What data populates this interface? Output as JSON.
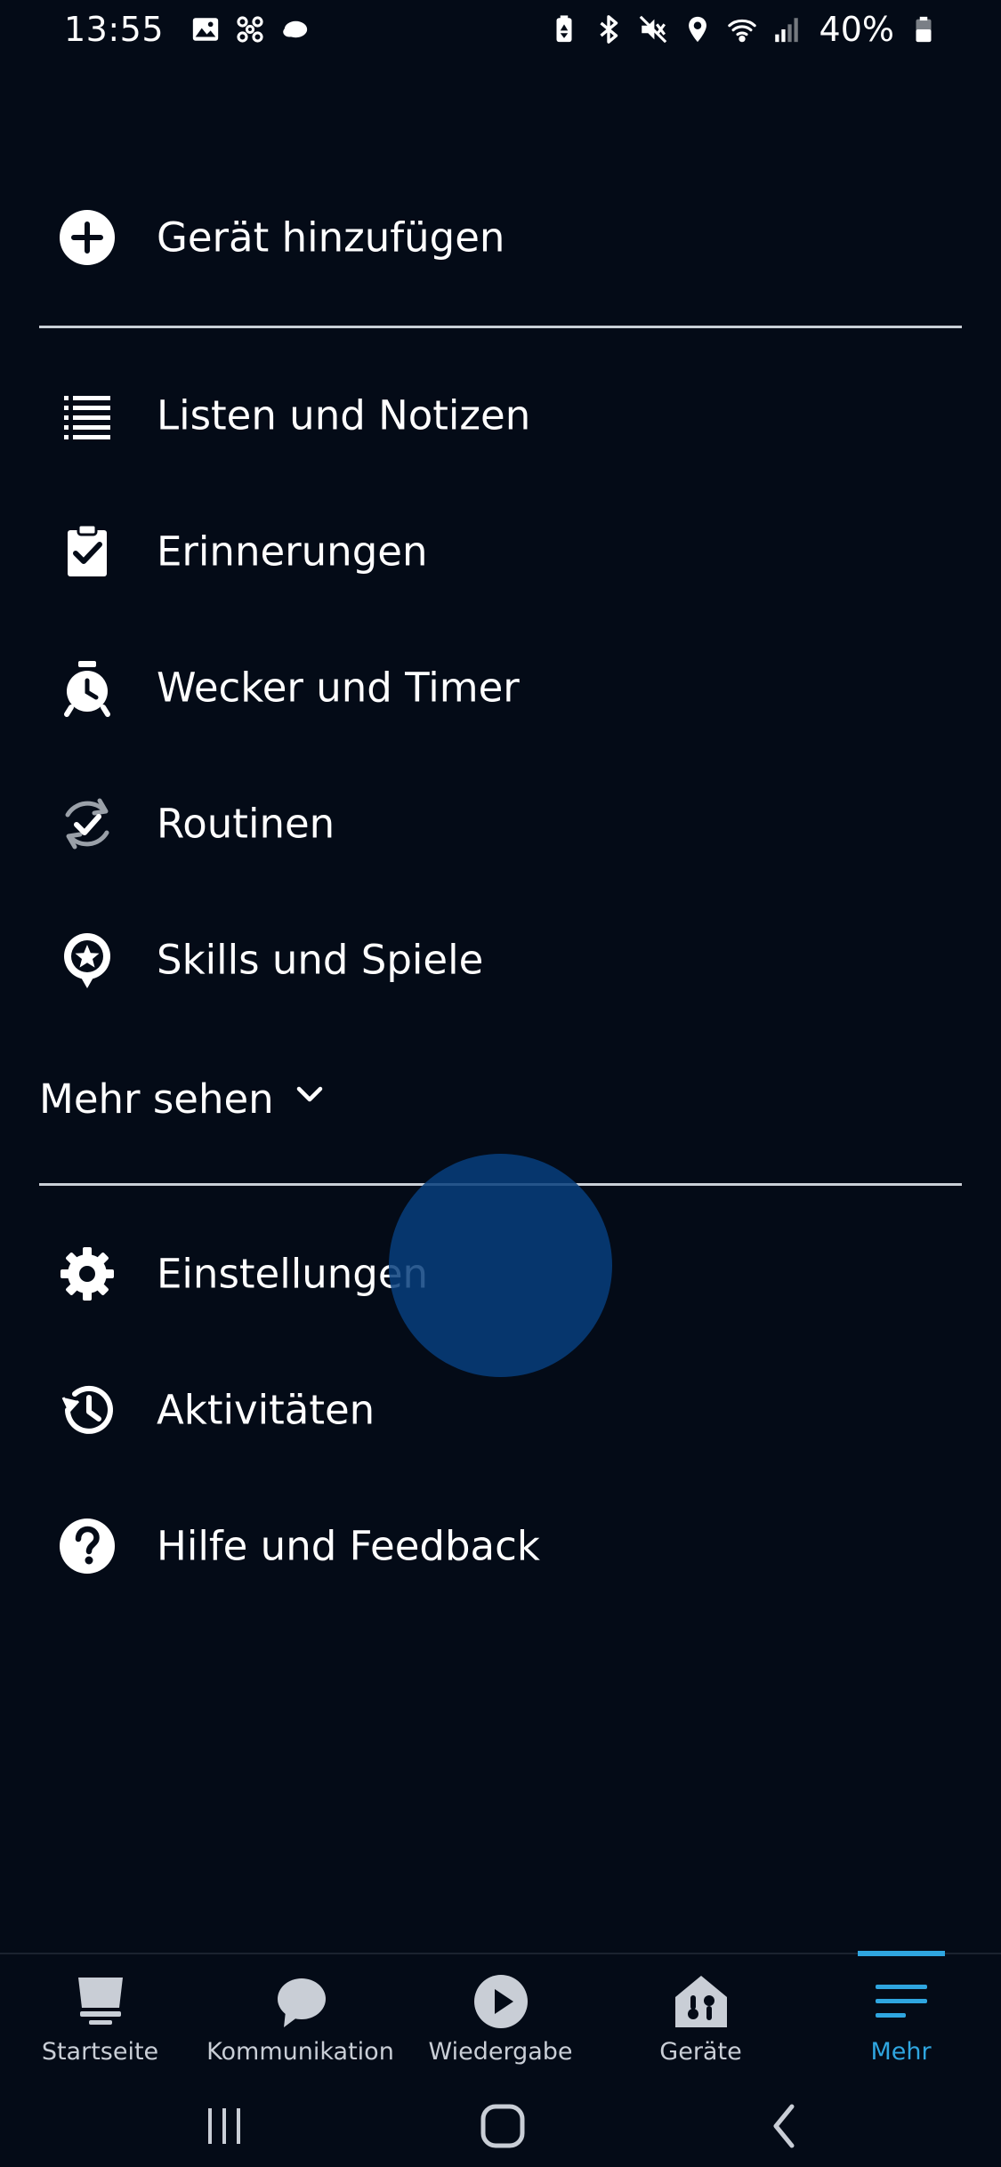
{
  "status_bar": {
    "time": "13:55",
    "battery": "40%",
    "left_icons": [
      "gallery-icon",
      "fan-icon",
      "cloud-icon"
    ],
    "right_icons": [
      "battery-saver-icon",
      "bluetooth-icon",
      "mute-icon",
      "location-icon",
      "wifi-icon",
      "signal-icon",
      "battery-icon"
    ]
  },
  "menu": {
    "add_device": {
      "label": "Gerät hinzufügen",
      "icon": "plus-circle-icon"
    },
    "items": [
      {
        "label": "Listen und Notizen",
        "icon": "list-icon"
      },
      {
        "label": "Erinnerungen",
        "icon": "clipboard-check-icon"
      },
      {
        "label": "Wecker und Timer",
        "icon": "alarm-clock-icon"
      },
      {
        "label": "Routinen",
        "icon": "routine-icon"
      },
      {
        "label": "Skills und Spiele",
        "icon": "star-bubble-icon"
      }
    ],
    "more": {
      "label": "Mehr sehen",
      "icon": "chevron-down-icon"
    },
    "settings_items": [
      {
        "label": "Einstellungen",
        "icon": "gear-icon"
      },
      {
        "label": "Aktivitäten",
        "icon": "history-icon"
      },
      {
        "label": "Hilfe und Feedback",
        "icon": "help-icon"
      }
    ]
  },
  "bottom_nav": {
    "items": [
      {
        "label": "Startseite",
        "icon": "home-icon"
      },
      {
        "label": "Kommunikation",
        "icon": "chat-bubble-icon"
      },
      {
        "label": "Wiedergabe",
        "icon": "play-icon"
      },
      {
        "label": "Geräte",
        "icon": "devices-house-icon"
      },
      {
        "label": "Mehr",
        "icon": "menu-lines-icon"
      }
    ],
    "active_index": 4
  },
  "colors": {
    "background": "#040b17",
    "text": "#ffffff",
    "accent": "#2fa6e0",
    "nav_inactive": "#c9ced6",
    "divider": "#c9cfd6",
    "touch": "#073e7c"
  }
}
